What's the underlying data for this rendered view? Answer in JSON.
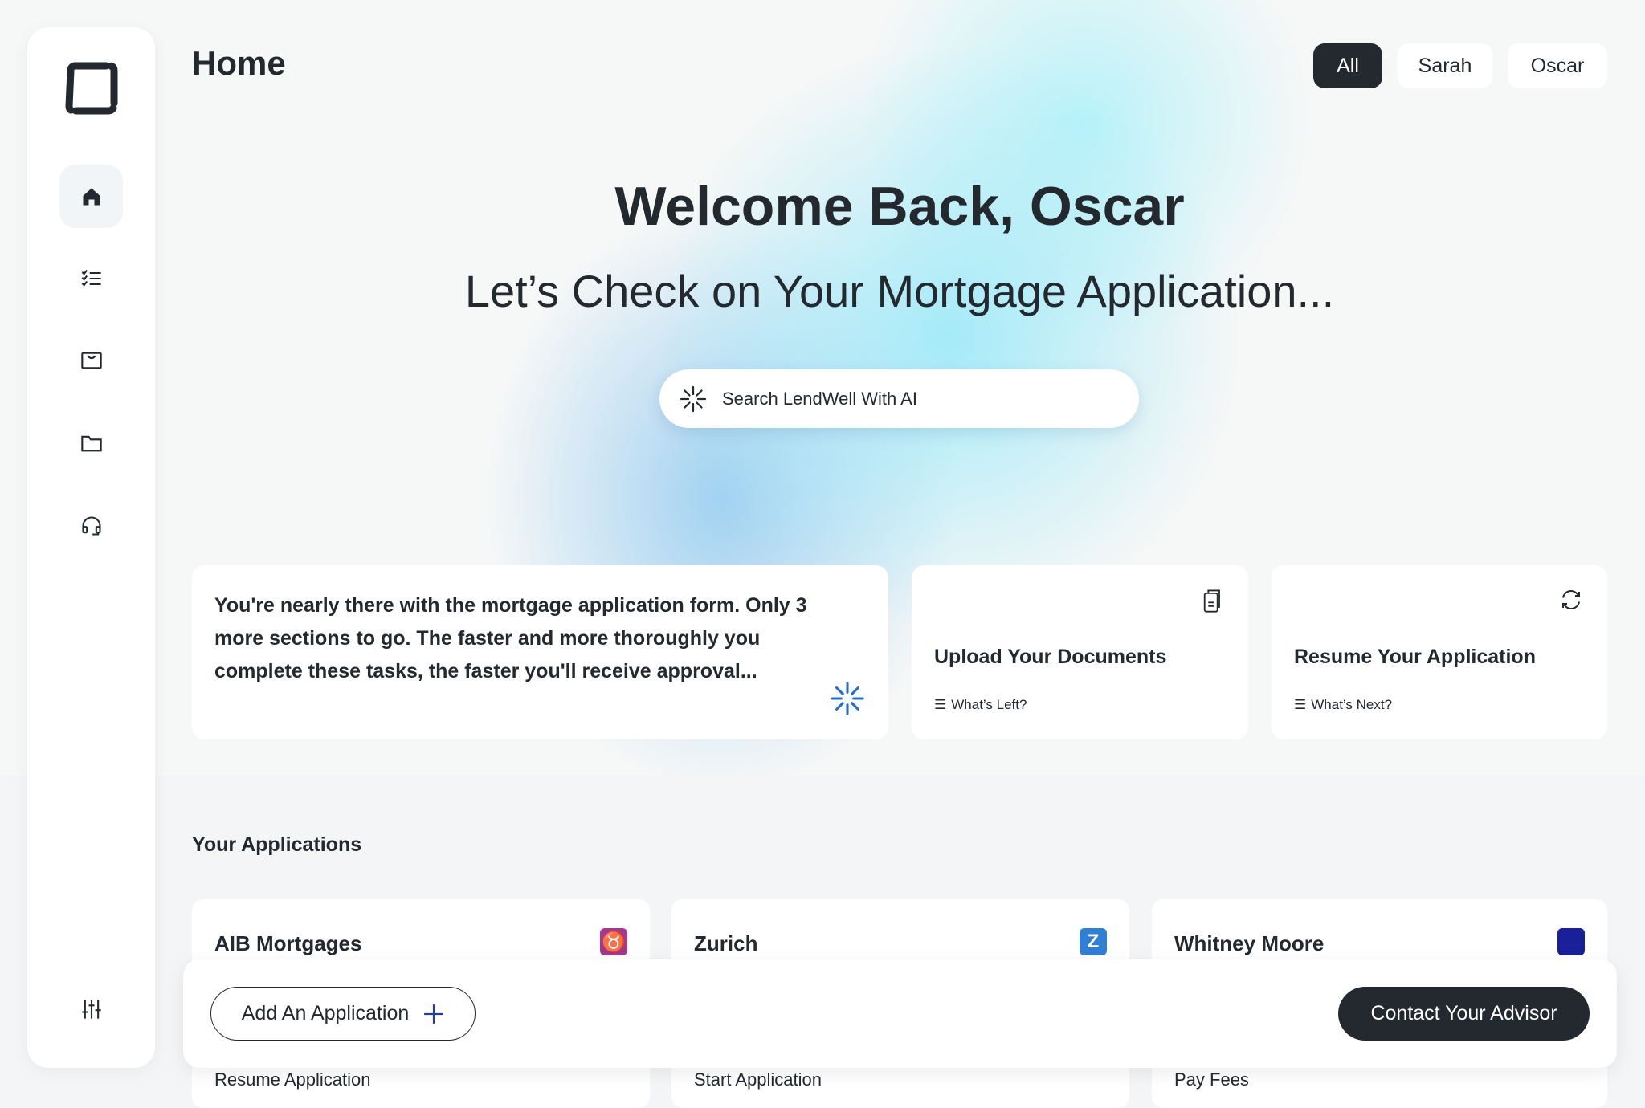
{
  "header": {
    "title": "Home",
    "filters": [
      {
        "label": "All",
        "selected": true
      },
      {
        "label": "Sarah",
        "selected": false
      },
      {
        "label": "Oscar",
        "selected": false
      }
    ]
  },
  "sidebar": {
    "items": [
      {
        "icon": "home-icon",
        "active": true
      },
      {
        "icon": "checklist-icon"
      },
      {
        "icon": "inbox-icon"
      },
      {
        "icon": "folder-icon"
      },
      {
        "icon": "headset-icon"
      }
    ],
    "bottom_icon": "sliders-icon"
  },
  "hero": {
    "welcome": "Welcome Back, Oscar",
    "subtitle": "Let’s Check on Your Mortgage Application...",
    "search_placeholder": "Search LendWell With AI"
  },
  "cards": {
    "progress_text": "You're nearly there with the mortgage application form. Only 3 more sections to go. The faster and more thoroughly you complete these tasks, the faster you'll receive approval...",
    "upload": {
      "title": "Upload Your Documents",
      "link": "What’s Left?"
    },
    "resume": {
      "title": "Resume Your Application",
      "link": "What’s Next?"
    }
  },
  "applications": {
    "heading": "Your Applications",
    "items": [
      {
        "name": "AIB Mortgages",
        "action": "Resume Application",
        "color": "#a3388c"
      },
      {
        "name": "Zurich",
        "action": "Start Application",
        "color": "#2f7fd4"
      },
      {
        "name": "Whitney Moore",
        "action": "Pay Fees",
        "color": "#1a1f9a"
      }
    ]
  },
  "actions": {
    "add": "Add An Application",
    "contact": "Contact Your Advisor"
  },
  "colors": {
    "dark": "#23292e",
    "accent_blue": "#1f6fd1"
  }
}
